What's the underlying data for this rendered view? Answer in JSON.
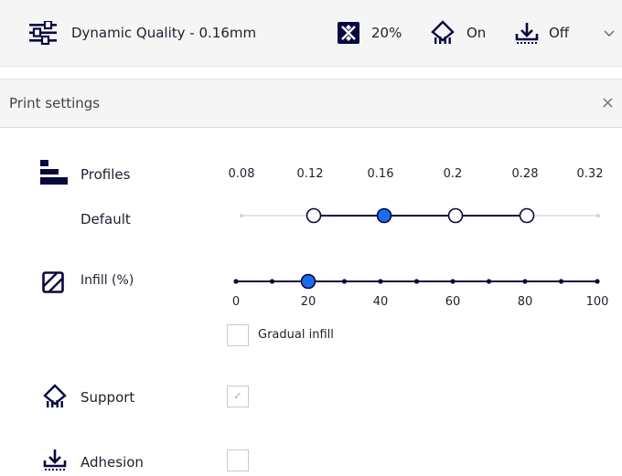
{
  "toolbar": {
    "profile_label": "Dynamic Quality - 0.16mm",
    "infill_value": "20%",
    "support_value": "On",
    "adhesion_value": "Off",
    "icons": [
      "sliders-icon",
      "infill-icon",
      "support-icon",
      "adhesion-icon",
      "chevron-down-icon"
    ]
  },
  "panel": {
    "title": "Print settings",
    "close_glyph": "×"
  },
  "profiles": {
    "label": "Profiles",
    "sublabel": "Default",
    "ticks": [
      "0.08",
      "0.12",
      "0.16",
      "0.2",
      "0.28",
      "0.32"
    ],
    "selected": "0.16",
    "available": [
      "0.12",
      "0.16",
      "0.2",
      "0.28"
    ]
  },
  "infill": {
    "label": "Infill (%)",
    "value": 20,
    "min": 0,
    "max": 100,
    "tick_labels": [
      "0",
      "20",
      "40",
      "60",
      "80",
      "100"
    ],
    "gradual_label": "Gradual infill",
    "gradual_checked": false
  },
  "support": {
    "label": "Support",
    "checked": true
  },
  "adhesion": {
    "label": "Adhesion",
    "checked": false
  },
  "colors": {
    "accent": "#196ef0",
    "dark": "#08073f",
    "header_bg": "#f5f5f6"
  }
}
